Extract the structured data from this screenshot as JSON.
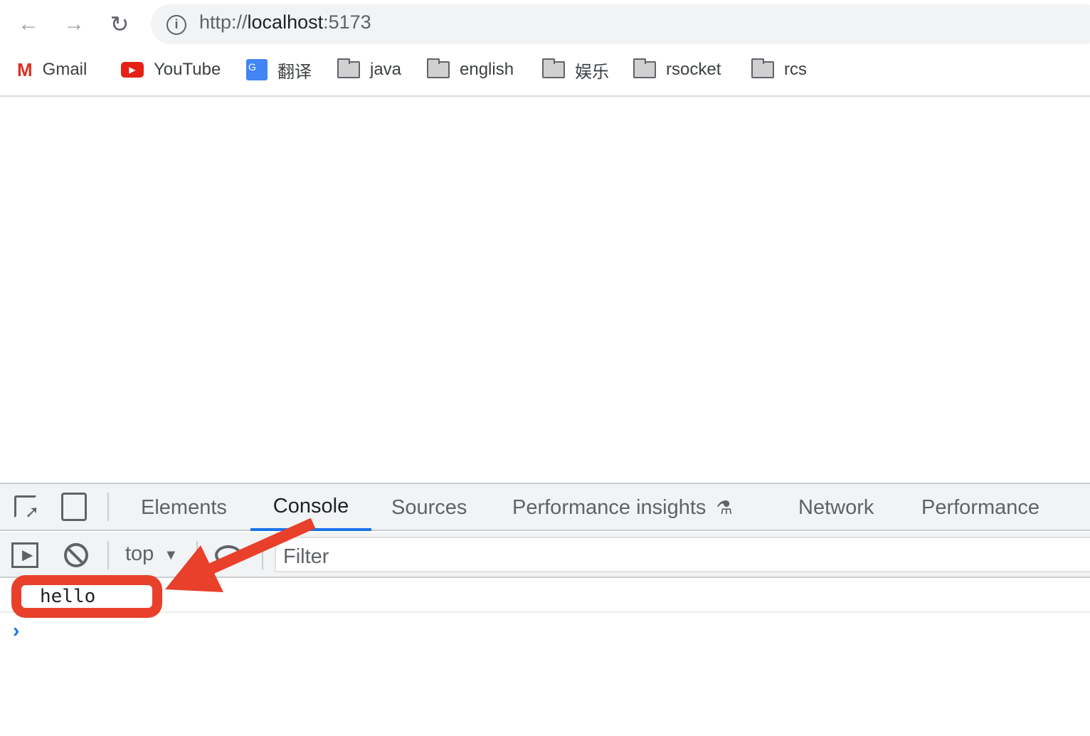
{
  "browser": {
    "url_scheme": "http://",
    "url_host": "localhost",
    "url_port": ":5173",
    "bookmarks": [
      {
        "label": "Gmail",
        "icon": "gmail-icon"
      },
      {
        "label": "YouTube",
        "icon": "youtube-icon"
      },
      {
        "label": "翻译",
        "icon": "google-translate-icon"
      },
      {
        "label": "java",
        "icon": "folder-icon"
      },
      {
        "label": "english",
        "icon": "folder-icon"
      },
      {
        "label": "娱乐",
        "icon": "folder-icon"
      },
      {
        "label": "rsocket",
        "icon": "folder-icon"
      },
      {
        "label": "rcs",
        "icon": "folder-icon"
      }
    ]
  },
  "devtools": {
    "tabs": [
      "Elements",
      "Console",
      "Sources",
      "Performance insights",
      "Network",
      "Performance"
    ],
    "active_tab": "Console",
    "context": "top",
    "filter_placeholder": "Filter",
    "console_messages": [
      "hello"
    ]
  },
  "colors": {
    "accent": "#1a73e8",
    "annotation": "#e8402a"
  }
}
